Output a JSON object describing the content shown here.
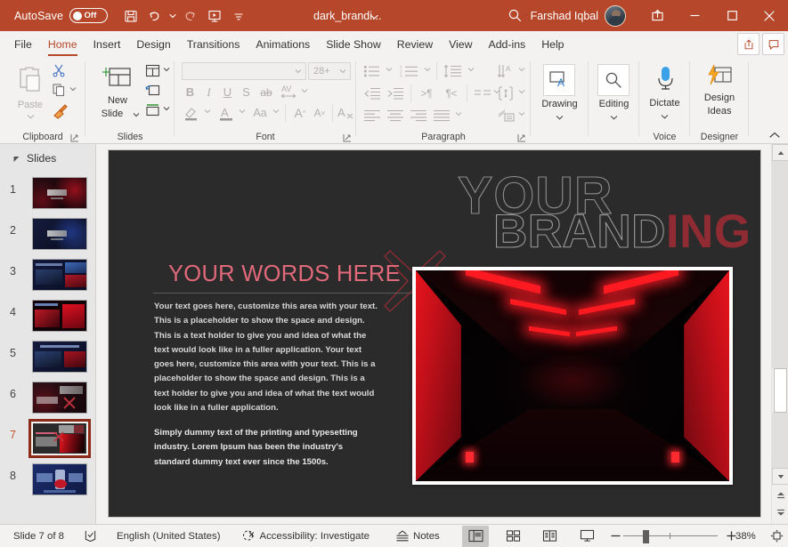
{
  "titlebar": {
    "autosave_label": "AutoSave",
    "autosave_state": "Off",
    "document_title": "dark_brandi...",
    "user_name": "Farshad Iqbal",
    "icons": {
      "save": "save-icon",
      "undo": "undo-icon",
      "redo": "redo-icon",
      "present": "start-presentation-icon",
      "more": "customize-quick-access-icon",
      "search": "search-icon",
      "share": "share-icon",
      "minimize": "minimize-icon",
      "maximize": "maximize-icon",
      "close": "close-icon"
    }
  },
  "tabs": [
    {
      "label": "File",
      "active": false
    },
    {
      "label": "Home",
      "active": true
    },
    {
      "label": "Insert",
      "active": false
    },
    {
      "label": "Design",
      "active": false
    },
    {
      "label": "Transitions",
      "active": false
    },
    {
      "label": "Animations",
      "active": false
    },
    {
      "label": "Slide Show",
      "active": false
    },
    {
      "label": "Review",
      "active": false
    },
    {
      "label": "View",
      "active": false
    },
    {
      "label": "Add-ins",
      "active": false
    },
    {
      "label": "Help",
      "active": false
    }
  ],
  "ribbon": {
    "groups": [
      {
        "name": "Clipboard",
        "label": "Clipboard"
      },
      {
        "name": "Slides",
        "label": "Slides"
      },
      {
        "name": "Font",
        "label": "Font"
      },
      {
        "name": "Paragraph",
        "label": "Paragraph"
      },
      {
        "name": "Drawing",
        "label": ""
      },
      {
        "name": "Editing",
        "label": ""
      },
      {
        "name": "Voice",
        "label": "Voice"
      },
      {
        "name": "Designer",
        "label": "Designer"
      }
    ],
    "paste_label": "Paste",
    "new_slide_label": "New\nSlide",
    "new_slide_line1": "New",
    "new_slide_line2": "Slide",
    "drawing_label": "Drawing",
    "editing_label": "Editing",
    "dictate_label": "Dictate",
    "design_ideas_line1": "Design",
    "design_ideas_line2": "Ideas",
    "font_name": "",
    "font_size": "28+",
    "font_buttons": [
      "B",
      "I",
      "U",
      "S",
      "ab",
      "AV",
      "A",
      "A",
      "Aa",
      "A^",
      "Av",
      "A"
    ]
  },
  "slides_panel": {
    "header": "Slides",
    "thumbnails": [
      {
        "number": "1",
        "selected": false,
        "theme": "dark-red-particles"
      },
      {
        "number": "2",
        "selected": false,
        "theme": "dark-blue-particles"
      },
      {
        "number": "3",
        "selected": false,
        "theme": "blue-content"
      },
      {
        "number": "4",
        "selected": false,
        "theme": "red-image-split"
      },
      {
        "number": "5",
        "selected": false,
        "theme": "blue-content-2"
      },
      {
        "number": "6",
        "selected": false,
        "theme": "dark-branding-x"
      },
      {
        "number": "7",
        "selected": true,
        "theme": "dark-branding-corridor"
      },
      {
        "number": "8",
        "selected": false,
        "theme": "blue-device"
      }
    ]
  },
  "slide": {
    "words_title": "YOUR WORDS HERE",
    "brand_line1": "YOUR",
    "brand_line2_outline": "BRAND",
    "brand_line2_filled": "ING",
    "body_paragraph": "Your text goes here, customize this area with your text. This is a placeholder to show the space and design. This is a text holder to give you and idea of what the text would look like in a fuller application. Your text goes here, customize this area with your text. This is a placeholder to show the space and design. This is a text holder to give you and idea of what the text would look like in a fuller application.",
    "body_paragraph2": "Simply dummy text of the printing and typesetting industry. Lorem Ipsum has been the industry's standard dummy text ever since the 1500s.",
    "image_alt": "dark corridor with red neon lights",
    "colors": {
      "background": "#2b2b2b",
      "title_pink": "#e0697a",
      "brand_red": "#8f2b32",
      "brand_outline": "#8e8e8e",
      "accent_red": "#ff1a22"
    }
  },
  "statusbar": {
    "slide_counter": "Slide 7 of 8",
    "language": "English (United States)",
    "accessibility": "Accessibility: Investigate",
    "notes_label": "Notes",
    "zoom_level": "38%",
    "views": [
      "normal-view",
      "slide-sorter-view",
      "reading-view",
      "slide-show-view"
    ],
    "icons": {
      "spelling": "spell-check-icon",
      "accessibility": "accessibility-icon",
      "notes": "notes-icon",
      "zoom_out": "zoom-out-icon",
      "zoom_in": "zoom-in-icon",
      "fit_slide": "fit-slide-to-window-icon"
    }
  }
}
